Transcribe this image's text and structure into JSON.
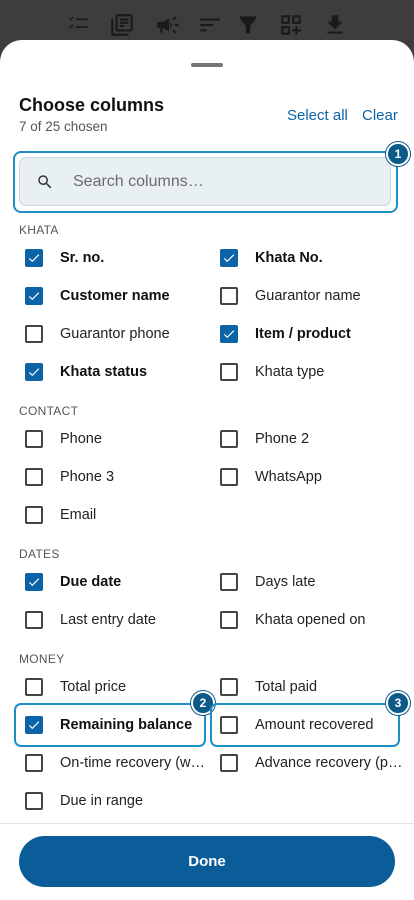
{
  "toolbar": {
    "icons": [
      "checklist-icon",
      "library-icon",
      "campaign-icon",
      "sort-icon",
      "filter-icon",
      "qr-add-icon",
      "download-icon"
    ]
  },
  "sheet": {
    "title": "Choose columns",
    "subtitle": "7 of 25 chosen",
    "select_all": "Select all",
    "clear": "Clear"
  },
  "search": {
    "placeholder": "Search columns…",
    "value": ""
  },
  "sections": [
    {
      "label": "KHATA",
      "options": [
        {
          "label": "Sr. no.",
          "checked": true
        },
        {
          "label": "Khata No.",
          "checked": true
        },
        {
          "label": "Customer name",
          "checked": true
        },
        {
          "label": "Guarantor name",
          "checked": false
        },
        {
          "label": "Guarantor phone",
          "checked": false
        },
        {
          "label": "Item / product",
          "checked": true
        },
        {
          "label": "Khata status",
          "checked": true
        },
        {
          "label": "Khata type",
          "checked": false
        }
      ]
    },
    {
      "label": "CONTACT",
      "options": [
        {
          "label": "Phone",
          "checked": false
        },
        {
          "label": "Phone 2",
          "checked": false
        },
        {
          "label": "Phone 3",
          "checked": false
        },
        {
          "label": "WhatsApp",
          "checked": false
        },
        {
          "label": "Email",
          "checked": false
        }
      ]
    },
    {
      "label": "DATES",
      "options": [
        {
          "label": "Due date",
          "checked": true
        },
        {
          "label": "Days late",
          "checked": false
        },
        {
          "label": "Last entry date",
          "checked": false
        },
        {
          "label": "Khata opened on",
          "checked": false
        }
      ]
    },
    {
      "label": "MONEY",
      "options": [
        {
          "label": "Total price",
          "checked": false
        },
        {
          "label": "Total paid",
          "checked": false
        },
        {
          "label": "Remaining balance",
          "checked": true
        },
        {
          "label": "Amount recovered",
          "checked": false
        },
        {
          "label": "On-time recovery (w…",
          "checked": false
        },
        {
          "label": "Advance recovery (p…",
          "checked": false
        },
        {
          "label": "Due in range",
          "checked": false
        }
      ]
    }
  ],
  "callouts": [
    "1",
    "2",
    "3"
  ],
  "done_label": "Done",
  "colors": {
    "accent": "#0b63a8",
    "highlight": "#1d8fc8",
    "done_button": "#0b5d99"
  }
}
